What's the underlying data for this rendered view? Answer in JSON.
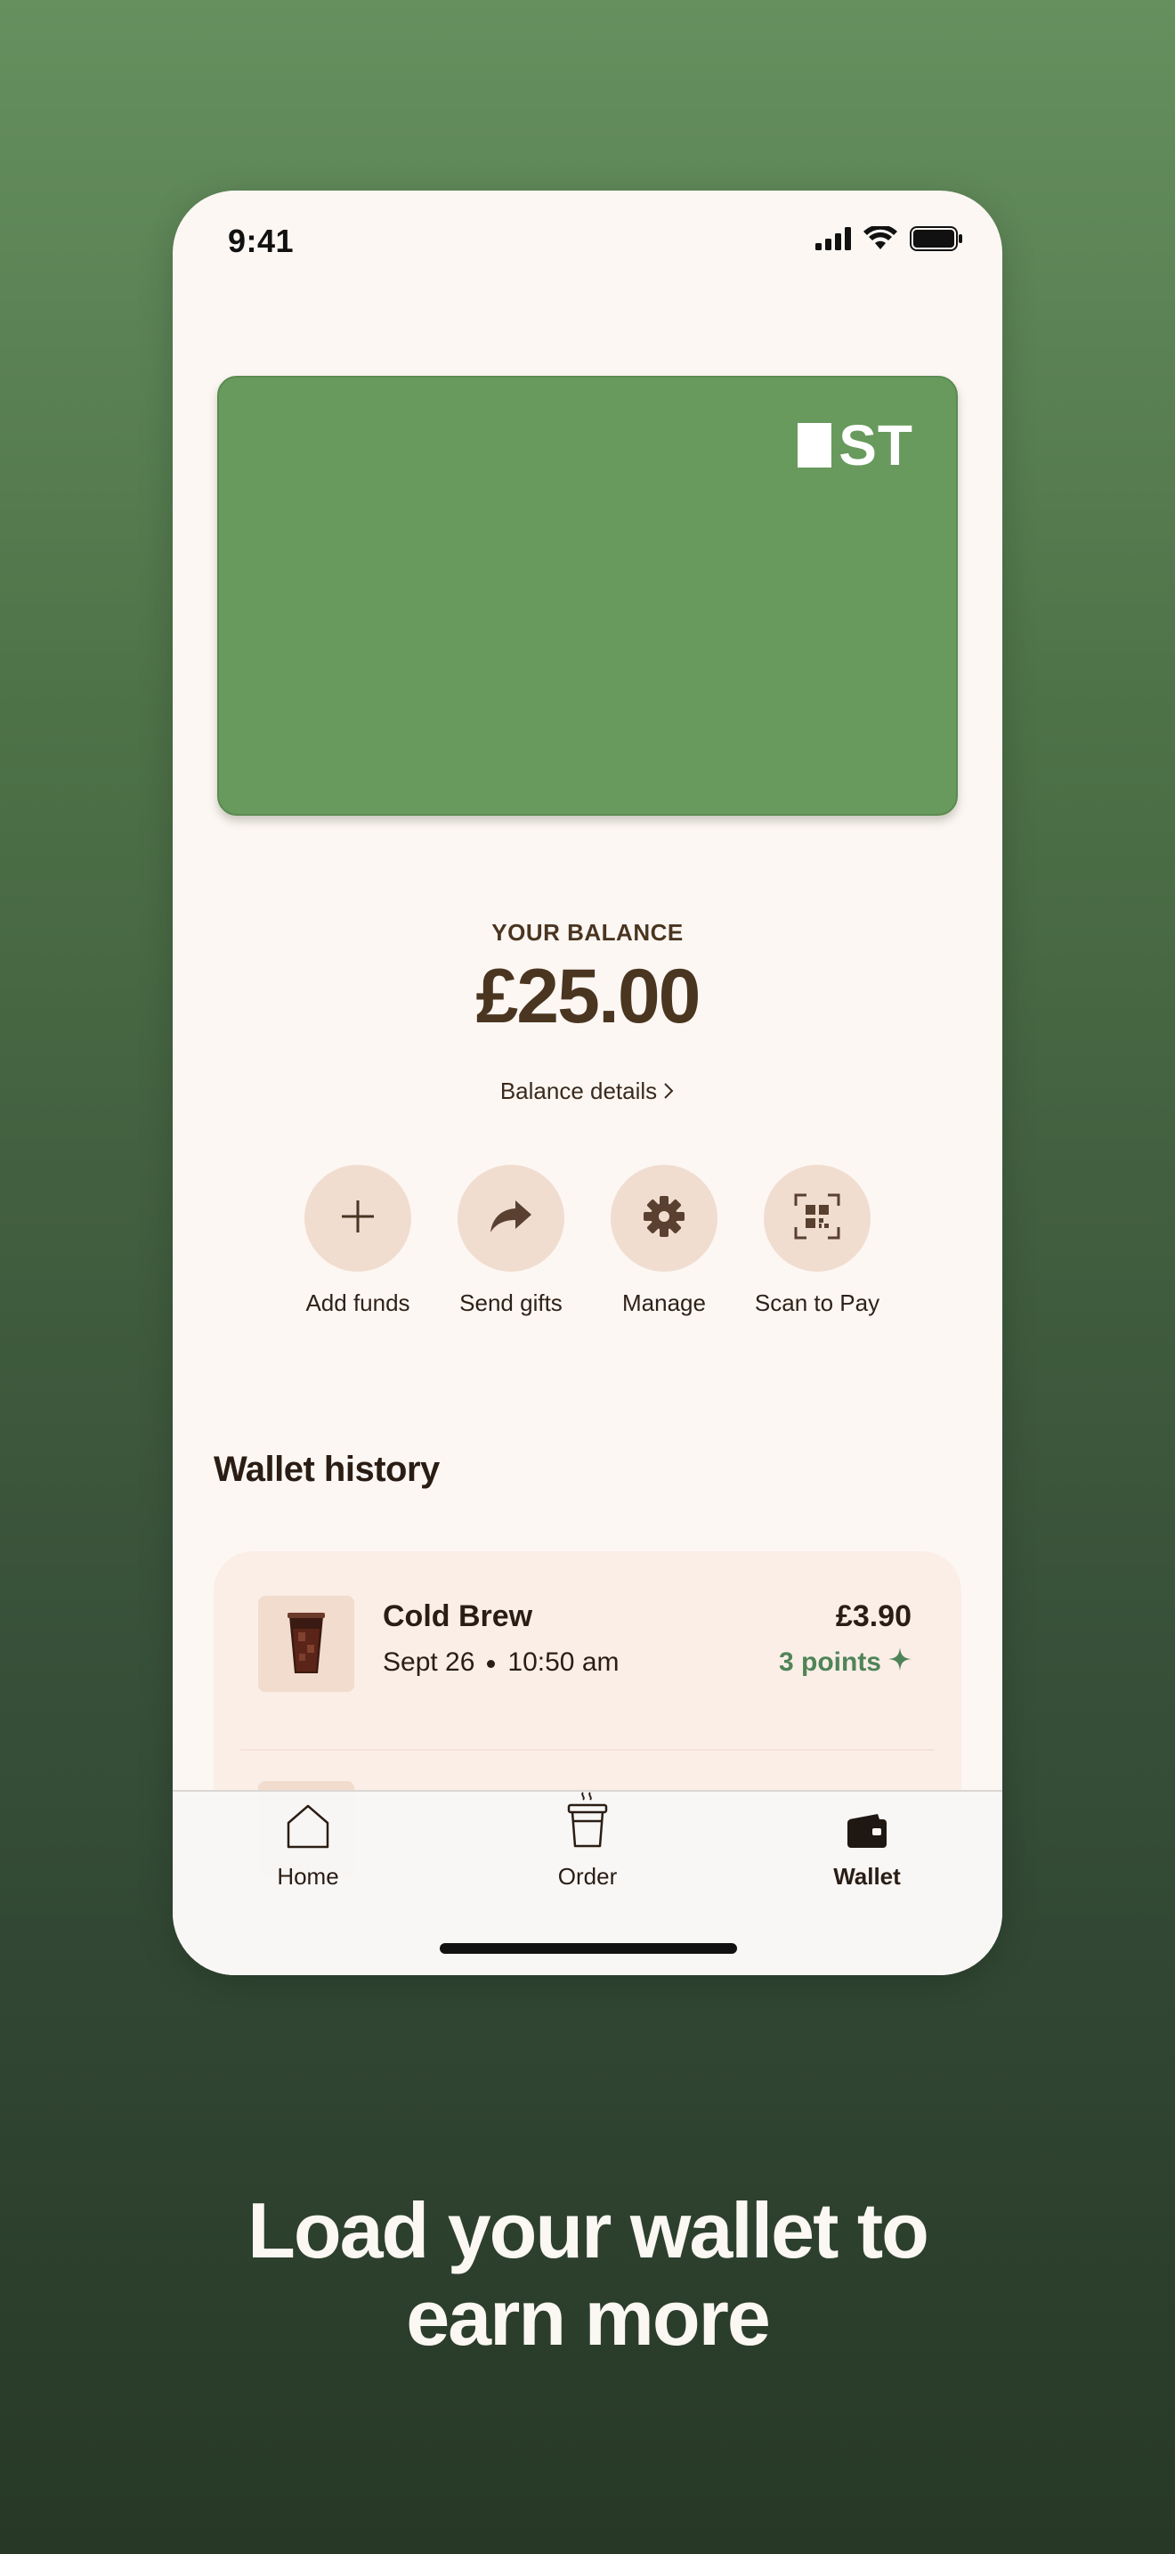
{
  "status_bar": {
    "time": "9:41"
  },
  "card": {
    "logo_text": "ST",
    "color": "#679a5c"
  },
  "balance": {
    "label": "YOUR BALANCE",
    "amount": "£25.00",
    "details_link": "Balance details"
  },
  "actions": [
    {
      "label": "Add funds",
      "icon": "plus-icon"
    },
    {
      "label": "Send gifts",
      "icon": "share-arrow-icon"
    },
    {
      "label": "Manage",
      "icon": "gear-icon"
    },
    {
      "label": "Scan to Pay",
      "icon": "qr-scan-icon"
    }
  ],
  "wallet_history": {
    "title": "Wallet history",
    "items": [
      {
        "name": "Cold Brew",
        "date": "Sept 26",
        "time": "10:50 am",
        "price": "£3.90",
        "points": "3 points",
        "icon": "cold-brew-cup-icon"
      }
    ]
  },
  "tab_bar": {
    "tabs": [
      {
        "label": "Home",
        "icon": "home-icon",
        "active": false
      },
      {
        "label": "Order",
        "icon": "coffee-cup-icon",
        "active": false
      },
      {
        "label": "Wallet",
        "icon": "wallet-icon",
        "active": true
      }
    ]
  },
  "headline": {
    "line1": "Load your wallet to",
    "line2": "earn more"
  },
  "colors": {
    "background_top": "#66905e",
    "background_bottom": "#273826",
    "screen_bg": "#fdf7f3",
    "action_circle": "#f0ddd0",
    "text_brown": "#4a3520",
    "points_green": "#4f8458"
  }
}
